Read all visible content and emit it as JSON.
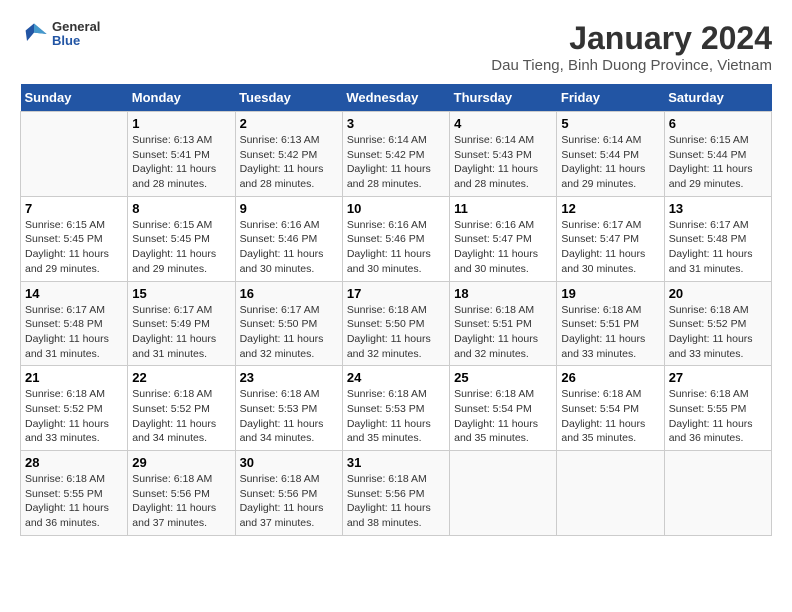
{
  "header": {
    "logo_general": "General",
    "logo_blue": "Blue",
    "title": "January 2024",
    "subtitle": "Dau Tieng, Binh Duong Province, Vietnam"
  },
  "days_of_week": [
    "Sunday",
    "Monday",
    "Tuesday",
    "Wednesday",
    "Thursday",
    "Friday",
    "Saturday"
  ],
  "weeks": [
    [
      {
        "day": "",
        "info": ""
      },
      {
        "day": "1",
        "info": "Sunrise: 6:13 AM\nSunset: 5:41 PM\nDaylight: 11 hours\nand 28 minutes."
      },
      {
        "day": "2",
        "info": "Sunrise: 6:13 AM\nSunset: 5:42 PM\nDaylight: 11 hours\nand 28 minutes."
      },
      {
        "day": "3",
        "info": "Sunrise: 6:14 AM\nSunset: 5:42 PM\nDaylight: 11 hours\nand 28 minutes."
      },
      {
        "day": "4",
        "info": "Sunrise: 6:14 AM\nSunset: 5:43 PM\nDaylight: 11 hours\nand 28 minutes."
      },
      {
        "day": "5",
        "info": "Sunrise: 6:14 AM\nSunset: 5:44 PM\nDaylight: 11 hours\nand 29 minutes."
      },
      {
        "day": "6",
        "info": "Sunrise: 6:15 AM\nSunset: 5:44 PM\nDaylight: 11 hours\nand 29 minutes."
      }
    ],
    [
      {
        "day": "7",
        "info": "Sunrise: 6:15 AM\nSunset: 5:45 PM\nDaylight: 11 hours\nand 29 minutes."
      },
      {
        "day": "8",
        "info": "Sunrise: 6:15 AM\nSunset: 5:45 PM\nDaylight: 11 hours\nand 29 minutes."
      },
      {
        "day": "9",
        "info": "Sunrise: 6:16 AM\nSunset: 5:46 PM\nDaylight: 11 hours\nand 30 minutes."
      },
      {
        "day": "10",
        "info": "Sunrise: 6:16 AM\nSunset: 5:46 PM\nDaylight: 11 hours\nand 30 minutes."
      },
      {
        "day": "11",
        "info": "Sunrise: 6:16 AM\nSunset: 5:47 PM\nDaylight: 11 hours\nand 30 minutes."
      },
      {
        "day": "12",
        "info": "Sunrise: 6:17 AM\nSunset: 5:47 PM\nDaylight: 11 hours\nand 30 minutes."
      },
      {
        "day": "13",
        "info": "Sunrise: 6:17 AM\nSunset: 5:48 PM\nDaylight: 11 hours\nand 31 minutes."
      }
    ],
    [
      {
        "day": "14",
        "info": "Sunrise: 6:17 AM\nSunset: 5:48 PM\nDaylight: 11 hours\nand 31 minutes."
      },
      {
        "day": "15",
        "info": "Sunrise: 6:17 AM\nSunset: 5:49 PM\nDaylight: 11 hours\nand 31 minutes."
      },
      {
        "day": "16",
        "info": "Sunrise: 6:17 AM\nSunset: 5:50 PM\nDaylight: 11 hours\nand 32 minutes."
      },
      {
        "day": "17",
        "info": "Sunrise: 6:18 AM\nSunset: 5:50 PM\nDaylight: 11 hours\nand 32 minutes."
      },
      {
        "day": "18",
        "info": "Sunrise: 6:18 AM\nSunset: 5:51 PM\nDaylight: 11 hours\nand 32 minutes."
      },
      {
        "day": "19",
        "info": "Sunrise: 6:18 AM\nSunset: 5:51 PM\nDaylight: 11 hours\nand 33 minutes."
      },
      {
        "day": "20",
        "info": "Sunrise: 6:18 AM\nSunset: 5:52 PM\nDaylight: 11 hours\nand 33 minutes."
      }
    ],
    [
      {
        "day": "21",
        "info": "Sunrise: 6:18 AM\nSunset: 5:52 PM\nDaylight: 11 hours\nand 33 minutes."
      },
      {
        "day": "22",
        "info": "Sunrise: 6:18 AM\nSunset: 5:52 PM\nDaylight: 11 hours\nand 34 minutes."
      },
      {
        "day": "23",
        "info": "Sunrise: 6:18 AM\nSunset: 5:53 PM\nDaylight: 11 hours\nand 34 minutes."
      },
      {
        "day": "24",
        "info": "Sunrise: 6:18 AM\nSunset: 5:53 PM\nDaylight: 11 hours\nand 35 minutes."
      },
      {
        "day": "25",
        "info": "Sunrise: 6:18 AM\nSunset: 5:54 PM\nDaylight: 11 hours\nand 35 minutes."
      },
      {
        "day": "26",
        "info": "Sunrise: 6:18 AM\nSunset: 5:54 PM\nDaylight: 11 hours\nand 35 minutes."
      },
      {
        "day": "27",
        "info": "Sunrise: 6:18 AM\nSunset: 5:55 PM\nDaylight: 11 hours\nand 36 minutes."
      }
    ],
    [
      {
        "day": "28",
        "info": "Sunrise: 6:18 AM\nSunset: 5:55 PM\nDaylight: 11 hours\nand 36 minutes."
      },
      {
        "day": "29",
        "info": "Sunrise: 6:18 AM\nSunset: 5:56 PM\nDaylight: 11 hours\nand 37 minutes."
      },
      {
        "day": "30",
        "info": "Sunrise: 6:18 AM\nSunset: 5:56 PM\nDaylight: 11 hours\nand 37 minutes."
      },
      {
        "day": "31",
        "info": "Sunrise: 6:18 AM\nSunset: 5:56 PM\nDaylight: 11 hours\nand 38 minutes."
      },
      {
        "day": "",
        "info": ""
      },
      {
        "day": "",
        "info": ""
      },
      {
        "day": "",
        "info": ""
      }
    ]
  ]
}
